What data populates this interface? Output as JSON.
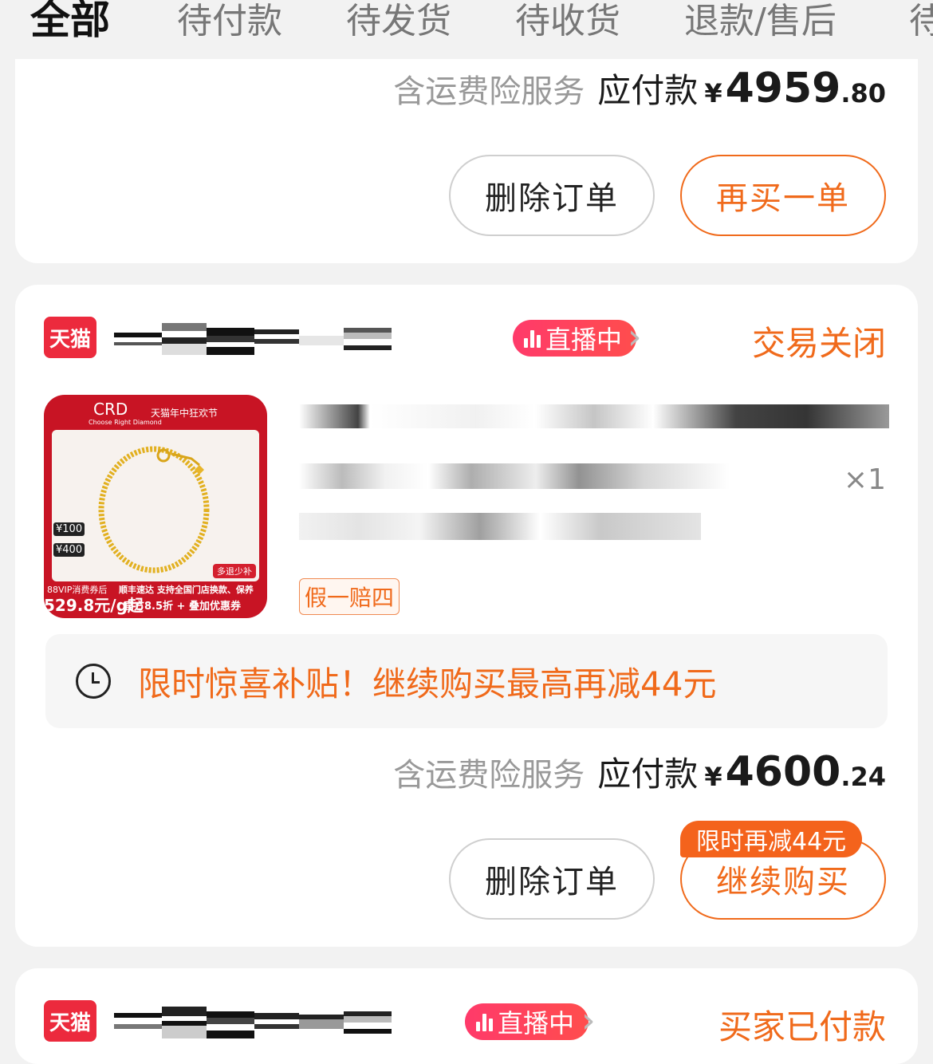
{
  "tabs": [
    {
      "label": "全部",
      "active": true
    },
    {
      "label": "待付款"
    },
    {
      "label": "待发货"
    },
    {
      "label": "待收货"
    },
    {
      "label": "退款/售后"
    },
    {
      "label": "待"
    }
  ],
  "orders": [
    {
      "price_note": "含运费险服务",
      "price_label": "应付款",
      "currency": "¥",
      "price_int": "4959",
      "price_dec": ".80",
      "buttons": {
        "delete": "删除订单",
        "rebuy": "再买一单"
      }
    },
    {
      "platform_badge": "天猫",
      "live_label": "直播中",
      "status": "交易关闭",
      "product_image": {
        "brand": "CRD",
        "brand_sub": "Choose Right Diamond",
        "event_tag": "天猫年中狂欢节",
        "coupon_1": "¥100",
        "coupon_2": "¥400",
        "refund_tag": "多退少补",
        "footer_left": "88VIP消费券后",
        "footer_price": "529.8元/g起",
        "footer_line1": "顺丰速达 支持全国门店换款、保养",
        "footer_line2": "官方8.5折 + 叠加优惠券"
      },
      "quantity": "×1",
      "guarantee": "假一赔四",
      "promo": "限时惊喜补贴！继续购买最高再减44元",
      "price_note": "含运费险服务",
      "price_label": "应付款",
      "currency": "¥",
      "price_int": "4600",
      "price_dec": ".24",
      "bubble": "限时再减44元",
      "buttons": {
        "delete": "删除订单",
        "continue": "继续购买"
      }
    },
    {
      "platform_badge": "天猫",
      "live_label": "直播中",
      "status": "买家已付款"
    }
  ],
  "colors": {
    "accent": "#f06a1b",
    "tmall_red": "#ec2a3d",
    "live_pink": "#ff3a6a"
  }
}
